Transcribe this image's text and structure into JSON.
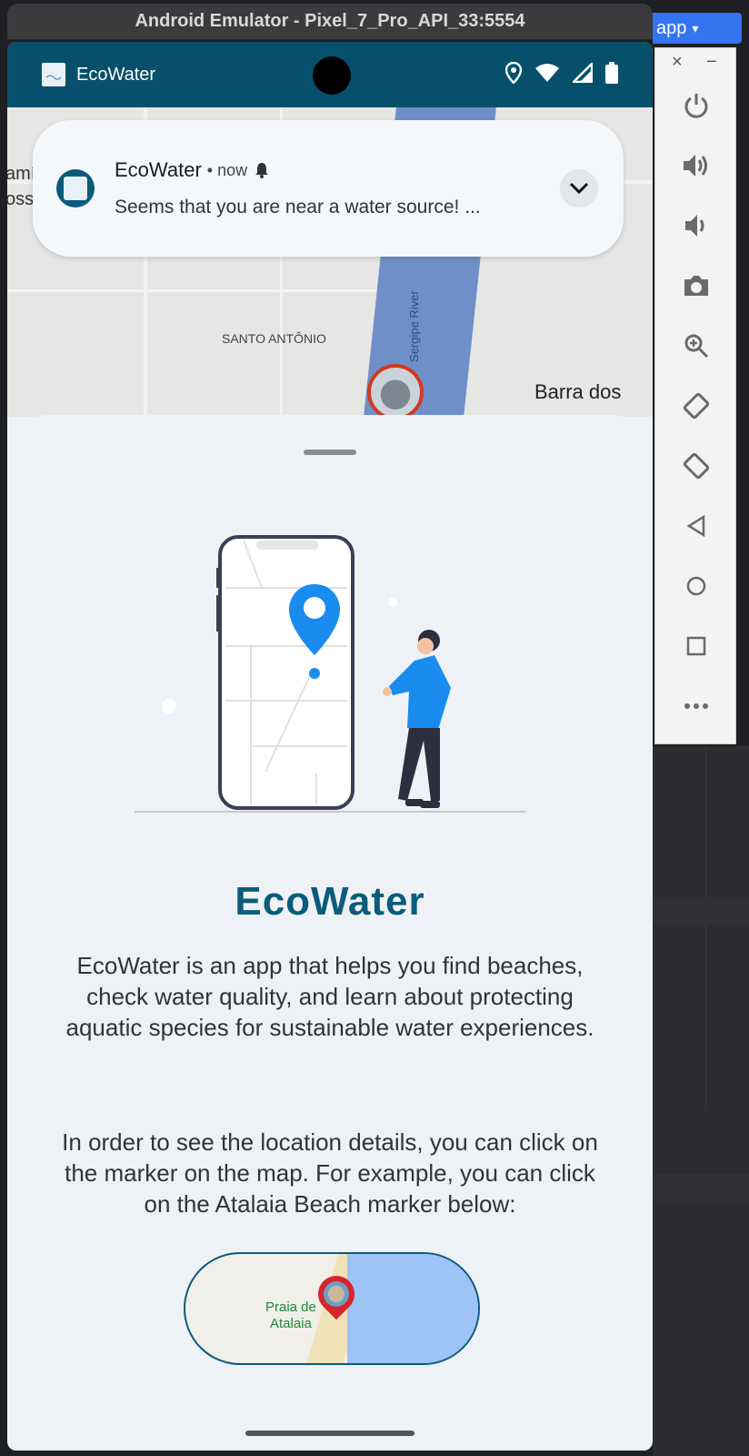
{
  "emulator": {
    "title": "Android Emulator - Pixel_7_Pro_API_33:5554"
  },
  "ide": {
    "run_config": "app"
  },
  "status_bar": {
    "app_name": "EcoWater"
  },
  "map": {
    "neighborhood_label": "SANTO ANTÔNIO",
    "river_label": "Sergipe River",
    "place_label": "Barra dos",
    "edge_text_1": "amíli",
    "edge_text_2": "oss"
  },
  "notification": {
    "app_name": "EcoWater",
    "time": "• now",
    "body": "Seems that you are near a water source! ..."
  },
  "sheet": {
    "title": "EcoWater",
    "description": "EcoWater is an app that helps you find beaches, check water quality, and learn about protecting aquatic species for sustainable water experiences.",
    "instruction": "In order to see the location details, you can click on the marker on the map. For example, you can click on the Atalaia Beach marker below:",
    "example_marker_label_line1": "Praia de",
    "example_marker_label_line2": "Atalaia"
  },
  "colors": {
    "brand": "#0a5c7a",
    "status_bar": "#06506c",
    "accent_blue": "#1a8cf0"
  },
  "tool_panel": {
    "icons": [
      "power-icon",
      "volume-up-icon",
      "volume-down-icon",
      "camera-icon",
      "zoom-icon",
      "rotate-left-icon",
      "rotate-right-icon",
      "back-icon",
      "home-icon",
      "overview-icon",
      "more-icon"
    ]
  }
}
